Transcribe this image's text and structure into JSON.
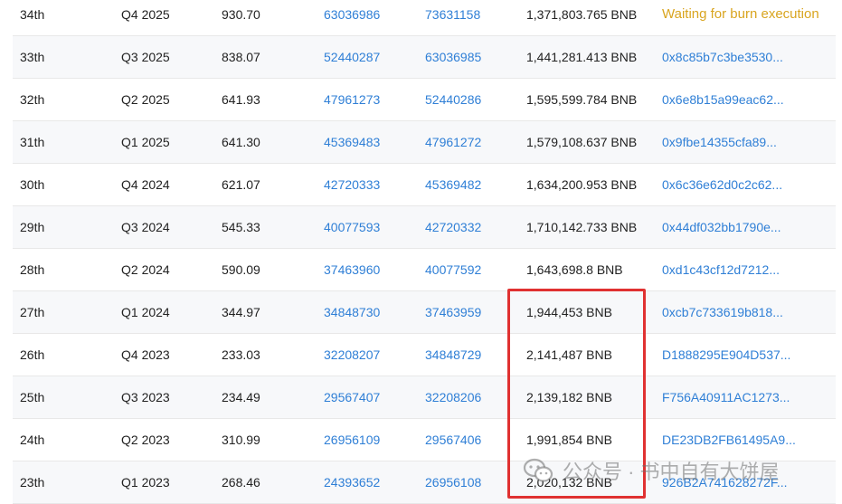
{
  "rows": [
    {
      "rank": "34th",
      "quarter": "Q4 2025",
      "price": "930.70",
      "start_block": "63036986",
      "end_block": "73631158",
      "amount": "1,371,803.765 BNB",
      "tx": "Waiting for burn execution",
      "tx_pending": true
    },
    {
      "rank": "33th",
      "quarter": "Q3 2025",
      "price": "838.07",
      "start_block": "52440287",
      "end_block": "63036985",
      "amount": "1,441,281.413 BNB",
      "tx": "0x8c85b7c3be3530..."
    },
    {
      "rank": "32th",
      "quarter": "Q2 2025",
      "price": "641.93",
      "start_block": "47961273",
      "end_block": "52440286",
      "amount": "1,595,599.784 BNB",
      "tx": "0x6e8b15a99eac62..."
    },
    {
      "rank": "31th",
      "quarter": "Q1 2025",
      "price": "641.30",
      "start_block": "45369483",
      "end_block": "47961272",
      "amount": "1,579,108.637 BNB",
      "tx": "0x9fbe14355cfa89..."
    },
    {
      "rank": "30th",
      "quarter": "Q4 2024",
      "price": "621.07",
      "start_block": "42720333",
      "end_block": "45369482",
      "amount": "1,634,200.953 BNB",
      "tx": "0x6c36e62d0c2c62..."
    },
    {
      "rank": "29th",
      "quarter": "Q3 2024",
      "price": "545.33",
      "start_block": "40077593",
      "end_block": "42720332",
      "amount": "1,710,142.733 BNB",
      "tx": "0x44df032bb1790e..."
    },
    {
      "rank": "28th",
      "quarter": "Q2 2024",
      "price": "590.09",
      "start_block": "37463960",
      "end_block": "40077592",
      "amount": "1,643,698.8 BNB",
      "tx": "0xd1c43cf12d7212..."
    },
    {
      "rank": "27th",
      "quarter": "Q1 2024",
      "price": "344.97",
      "start_block": "34848730",
      "end_block": "37463959",
      "amount": "1,944,453 BNB",
      "tx": "0xcb7c733619b818..."
    },
    {
      "rank": "26th",
      "quarter": "Q4 2023",
      "price": "233.03",
      "start_block": "32208207",
      "end_block": "34848729",
      "amount": "2,141,487 BNB",
      "tx": "D1888295E904D537..."
    },
    {
      "rank": "25th",
      "quarter": "Q3 2023",
      "price": "234.49",
      "start_block": "29567407",
      "end_block": "32208206",
      "amount": "2,139,182 BNB",
      "tx": "F756A40911AC1273..."
    },
    {
      "rank": "24th",
      "quarter": "Q2 2023",
      "price": "310.99",
      "start_block": "26956109",
      "end_block": "29567406",
      "amount": "1,991,854 BNB",
      "tx": "DE23DB2FB61495A9..."
    },
    {
      "rank": "23th",
      "quarter": "Q1 2023",
      "price": "268.46",
      "start_block": "24393652",
      "end_block": "26956108",
      "amount": "2,020,132 BNB",
      "tx": "926B2A741628272F..."
    }
  ],
  "watermark": {
    "text": "公众号 · 书中自有大饼屋",
    "icon": "wechat-icon"
  },
  "colors": {
    "link": "#2f7fd6",
    "pending": "#d9a520",
    "highlight": "#e03131",
    "alt_row": "#f7f8fa"
  }
}
